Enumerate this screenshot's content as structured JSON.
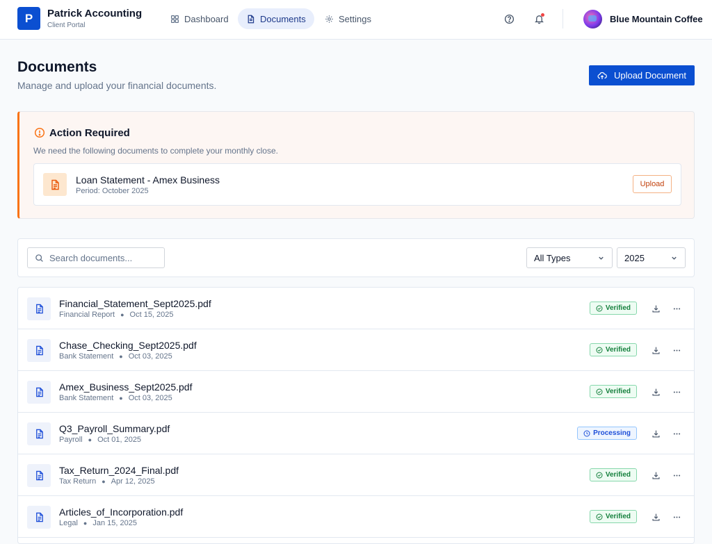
{
  "brand": {
    "logo_letter": "P",
    "name": "Patrick Accounting",
    "subtitle": "Client Portal",
    "accent_color": "#0b4fd1"
  },
  "nav": {
    "items": [
      {
        "label": "Dashboard",
        "icon": "grid-icon",
        "active": false
      },
      {
        "label": "Documents",
        "icon": "document-icon",
        "active": true
      },
      {
        "label": "Settings",
        "icon": "gear-icon",
        "active": false
      }
    ]
  },
  "header": {
    "icons": [
      "help-icon",
      "bell-icon"
    ],
    "client_name": "Blue Mountain Coffee"
  },
  "page": {
    "title": "Documents",
    "subtitle": "Manage and upload your financial documents.",
    "upload_button": "Upload Document"
  },
  "action_required": {
    "title": "Action Required",
    "description": "We need the following documents to complete your monthly close.",
    "accent_color": "#f97316",
    "items": [
      {
        "name": "Loan Statement - Amex Business",
        "period": "Period: October 2025",
        "button": "Upload"
      }
    ]
  },
  "filters": {
    "search_placeholder": "Search documents...",
    "search_value": "",
    "type_select": "All Types",
    "year_select": "2025"
  },
  "documents": [
    {
      "name": "Financial_Statement_Sept2025.pdf",
      "category": "Financial Report",
      "date": "Oct 15, 2025",
      "status": "Verified"
    },
    {
      "name": "Chase_Checking_Sept2025.pdf",
      "category": "Bank Statement",
      "date": "Oct 03, 2025",
      "status": "Verified"
    },
    {
      "name": "Amex_Business_Sept2025.pdf",
      "category": "Bank Statement",
      "date": "Oct 03, 2025",
      "status": "Verified"
    },
    {
      "name": "Q3_Payroll_Summary.pdf",
      "category": "Payroll",
      "date": "Oct 01, 2025",
      "status": "Processing"
    },
    {
      "name": "Tax_Return_2024_Final.pdf",
      "category": "Tax Return",
      "date": "Apr 12, 2025",
      "status": "Verified"
    },
    {
      "name": "Articles_of_Incorporation.pdf",
      "category": "Legal",
      "date": "Jan 15, 2025",
      "status": "Verified"
    }
  ],
  "status_colors": {
    "Verified": "#15803d",
    "Processing": "#1d4ed8"
  }
}
